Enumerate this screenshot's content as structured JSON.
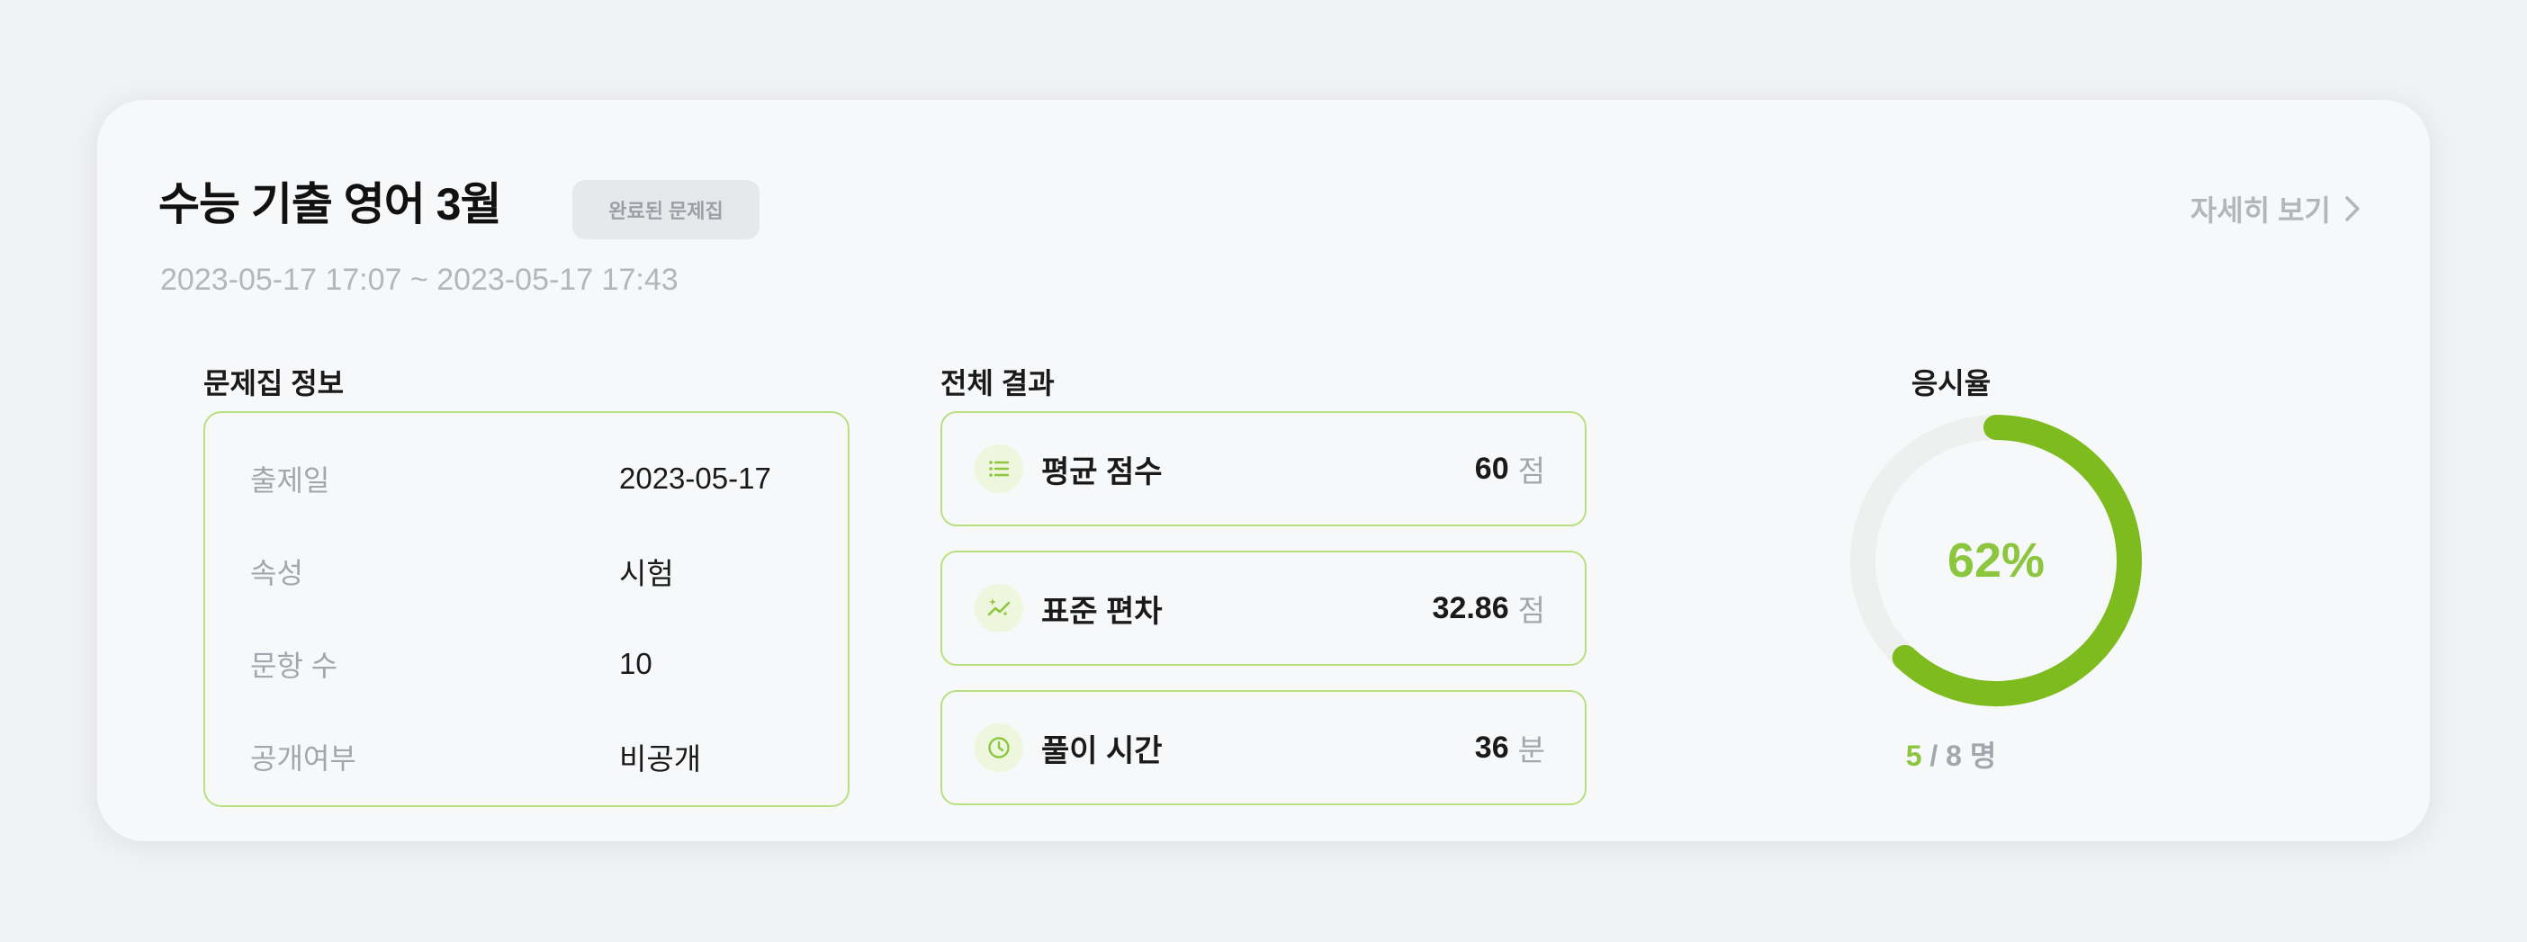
{
  "header": {
    "title": "수능 기출 영어 3월",
    "badge": "완료된 문제집",
    "date_range": "2023-05-17 17:07 ~ 2023-05-17 17:43",
    "detail_link": "자세히 보기"
  },
  "info": {
    "section_title": "문제집 정보",
    "rows": [
      {
        "key": "출제일",
        "value": "2023-05-17"
      },
      {
        "key": "속성",
        "value": "시험"
      },
      {
        "key": "문항 수",
        "value": "10"
      },
      {
        "key": "공개여부",
        "value": "비공개"
      }
    ]
  },
  "results": {
    "section_title": "전체 결과",
    "items": [
      {
        "icon": "list-icon",
        "label": "평균 점수",
        "value": "60",
        "unit": "점"
      },
      {
        "icon": "sparkle-trend-icon",
        "label": "표준 편차",
        "value": "32.86",
        "unit": "점"
      },
      {
        "icon": "clock-icon",
        "label": "풀이 시간",
        "value": "36",
        "unit": "분"
      }
    ]
  },
  "rate": {
    "title": "응시율",
    "percent_text": "62%",
    "percent": 62,
    "taken": "5",
    "separator": "/",
    "total": "8",
    "unit": "명"
  },
  "colors": {
    "accent": "#8cc63f",
    "ring": "#7dbb1f",
    "track": "#eeefef",
    "border": "#b8e07f"
  }
}
